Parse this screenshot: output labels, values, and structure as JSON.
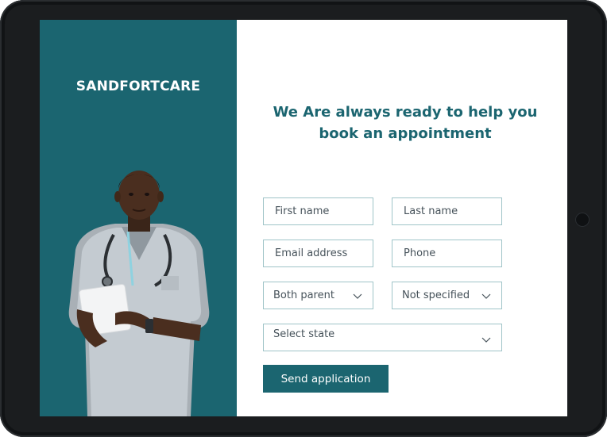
{
  "brand": {
    "name": "SANDFORTCARE"
  },
  "form": {
    "heading_line1": "We Are always ready to help you",
    "heading_line2": "book an appointment",
    "first_name": {
      "placeholder": "First name",
      "value": ""
    },
    "last_name": {
      "placeholder": "Last name",
      "value": ""
    },
    "email": {
      "placeholder": "Email address",
      "value": ""
    },
    "phone": {
      "placeholder": "Phone",
      "value": ""
    },
    "parent_select": {
      "selected": "Both parent"
    },
    "gender_select": {
      "selected": "Not specified"
    },
    "state_select": {
      "selected": "Select state"
    },
    "submit_label": "Send application"
  },
  "colors": {
    "brand_teal": "#1b6570",
    "field_border": "#9fc4c8",
    "text_gray": "#46525a",
    "tablet_frame": "#1b1d1f"
  },
  "icons": {
    "select_chevron": "chevron-down-icon"
  }
}
